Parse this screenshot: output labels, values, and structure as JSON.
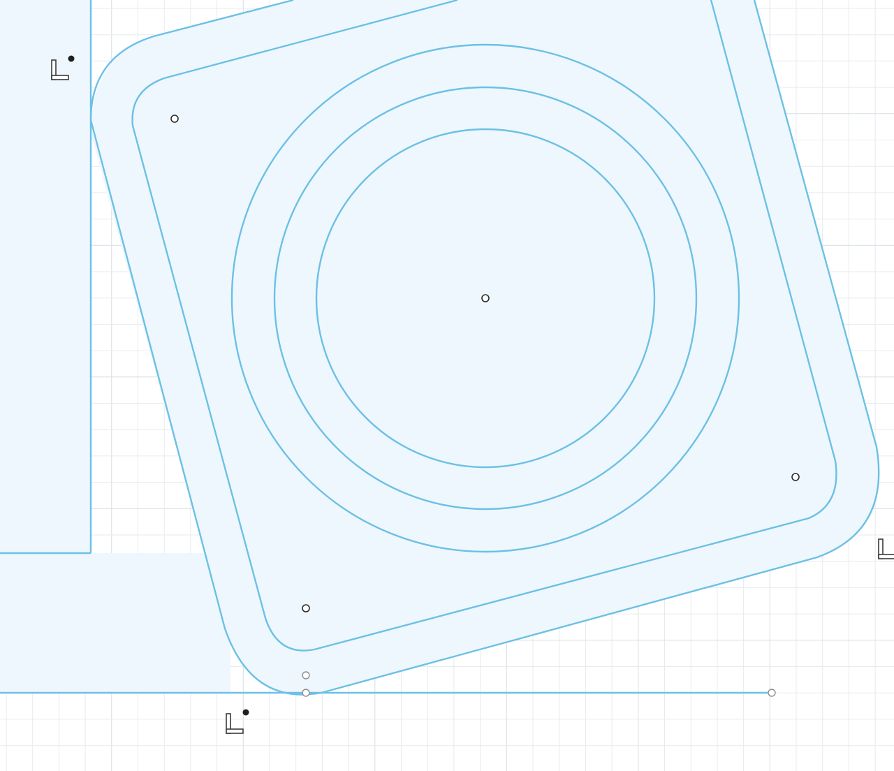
{
  "app": {
    "view": "sketch-canvas"
  },
  "colors": {
    "background": "#ffffff",
    "grid_minor": "#e6ebef",
    "grid_major": "#d5dde3",
    "profile_fill": "#eef7fd",
    "profile_stroke": "#6cc0e5",
    "point_stroke": "#2a2a2a"
  },
  "sketch": {
    "circles": [
      "inner-circle",
      "middle-circle",
      "outer-circle"
    ],
    "rectangles": [
      "outer-rounded-rectangle",
      "inner-rounded-rectangle"
    ],
    "constraints": [
      "perpendicular-constraint-icon",
      "perpendicular-constraint-icon",
      "perpendicular-constraint-icon"
    ]
  }
}
